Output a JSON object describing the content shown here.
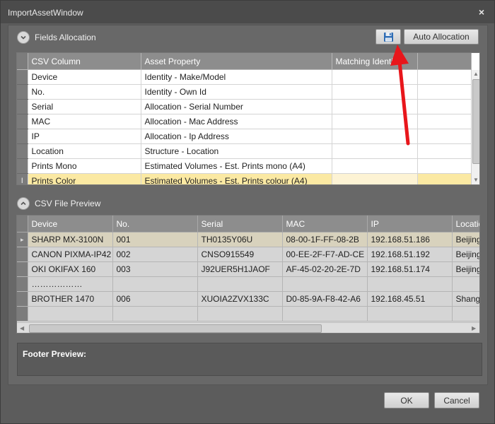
{
  "window": {
    "title": "ImportAssetWindow",
    "close_glyph": "×"
  },
  "fields_allocation": {
    "header": "Fields Allocation",
    "save_icon": "floppy-disk-icon",
    "auto_button": "Auto Allocation",
    "columns": [
      "CSV Column",
      "Asset Property",
      "Matching Identifier"
    ],
    "rows": [
      [
        "Device",
        "Identity - Make/Model",
        ""
      ],
      [
        "No.",
        "Identity - Own Id",
        ""
      ],
      [
        "Serial",
        "Allocation - Serial Number",
        ""
      ],
      [
        "MAC",
        "Allocation - Mac Address",
        ""
      ],
      [
        "IP",
        "Allocation - Ip Address",
        ""
      ],
      [
        "Location",
        "Structure - Location",
        ""
      ],
      [
        "Prints Mono",
        "Estimated Volumes - Est. Prints mono (A4)",
        ""
      ],
      [
        "Prints Color",
        "Estimated Volumes - Est. Prints colour (A4)",
        ""
      ]
    ],
    "selected_row": 7,
    "row_edit_indicator": "I"
  },
  "csv_preview": {
    "header": "CSV File Preview",
    "columns": [
      "Device",
      "No.",
      "Serial",
      "MAC",
      "IP",
      "Location"
    ],
    "rows": [
      [
        "SHARP MX-3100N",
        "001",
        "TH0135Y06U",
        "08-00-1F-FF-08-2B",
        "192.168.51.186",
        "Beijing"
      ],
      [
        "CANON PIXMA-IP42",
        "002",
        "CNSO915549",
        "00-EE-2F-F7-AD-CE",
        "192.168.51.192",
        "Beijing"
      ],
      [
        "OKI OKIFAX 160",
        "003",
        "J92UER5H1JAOF",
        "AF-45-02-20-2E-7D",
        "192.168.51.174",
        "Beijing"
      ],
      [
        "………………",
        "",
        "",
        "",
        "",
        ""
      ],
      [
        "BROTHER 1470",
        "006",
        "XUOIA2ZVX133C",
        "D0-85-9A-F8-42-A6",
        "192.168.45.51",
        "Shanghai"
      ],
      [
        "",
        "",
        "",
        "",
        "",
        ""
      ]
    ],
    "current_row_marker": "▸"
  },
  "footer_preview": {
    "label": "Footer Preview:"
  },
  "buttons": {
    "ok": "OK",
    "cancel": "Cancel"
  },
  "colors": {
    "accent_arrow": "#e8161b",
    "selected_row": "#fbe9a3",
    "header_bg": "#8d8d8d"
  }
}
